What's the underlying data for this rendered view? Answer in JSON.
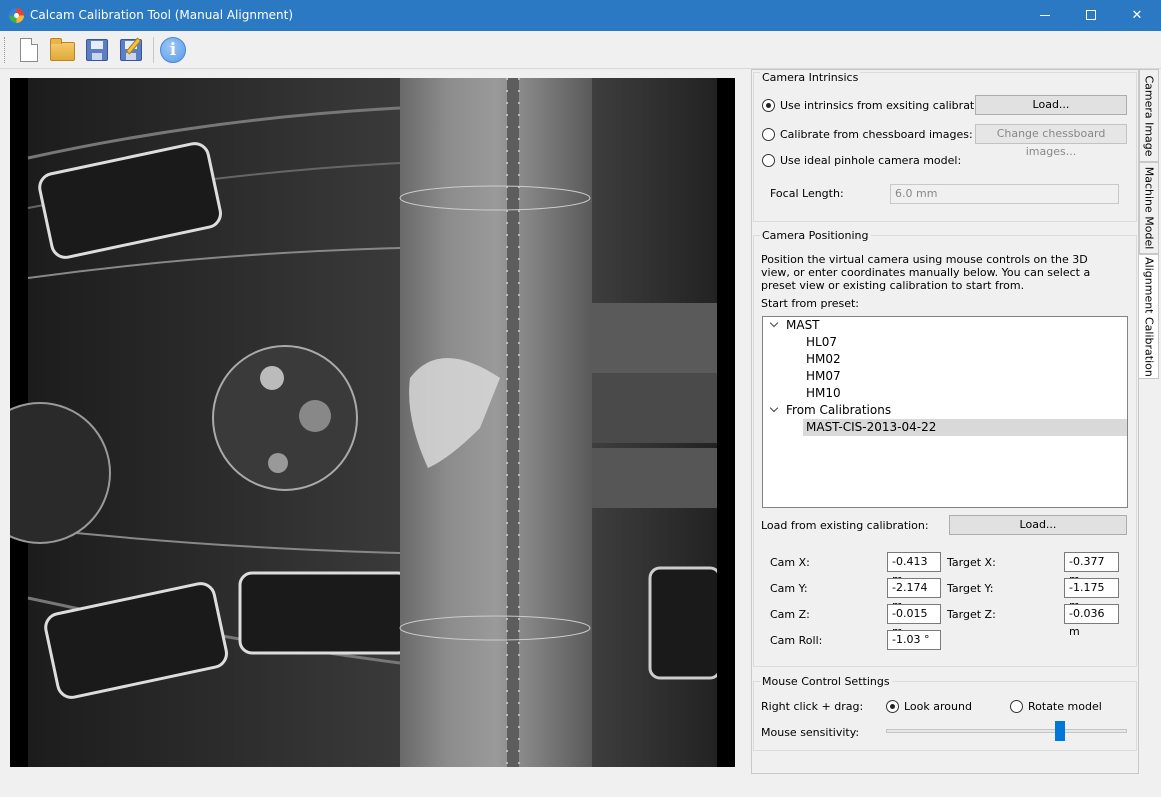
{
  "window": {
    "title": "Calcam Calibration Tool (Manual Alignment)",
    "minimize_glyph": "",
    "maximize_glyph": "",
    "close_glyph": "✕"
  },
  "toolbar": {
    "buttons": [
      "new-file-icon",
      "open-folder-icon",
      "save-icon",
      "save-as-icon",
      "info-icon"
    ],
    "info_glyph": "i"
  },
  "camera_intrinsics": {
    "title": "Camera Intrinsics",
    "option_existing": "Use intrinsics from exsiting calibration:",
    "option_existing_button": "Load...",
    "option_chessboard": "Calibrate from chessboard images:",
    "option_chessboard_button": "Change chessboard images...",
    "option_pinhole": "Use ideal pinhole camera model:",
    "focal_length_label": "Focal Length:",
    "focal_length_value": "6.0 mm",
    "selected": "existing"
  },
  "camera_positioning": {
    "title": "Camera Positioning",
    "description": "Position the virtual camera using mouse controls on the 3D view, or enter coordinates manually below. You can select a preset view or existing calibration to start from.",
    "preset_label": "Start from preset:",
    "tree": {
      "groups": [
        {
          "label": "MAST",
          "items": [
            "HL07",
            "HM02",
            "HM07",
            "HM10"
          ]
        },
        {
          "label": "From Calibrations",
          "items": [
            "MAST-CIS-2013-04-22"
          ]
        }
      ],
      "selected": "MAST-CIS-2013-04-22"
    },
    "load_existing_label": "Load from existing calibration:",
    "load_existing_button": "Load...",
    "cam_x_label": "Cam X:",
    "cam_x": "-0.413 m",
    "cam_y_label": "Cam Y:",
    "cam_y": "-2.174 m",
    "cam_z_label": "Cam Z:",
    "cam_z": "-0.015 m",
    "cam_roll_label": "Cam Roll:",
    "cam_roll": "-1.03 °",
    "target_x_label": "Target X:",
    "target_x": "-0.377 m",
    "target_y_label": "Target Y:",
    "target_y": "-1.175 m",
    "target_z_label": "Target Z:",
    "target_z": "-0.036 m"
  },
  "mouse_control": {
    "title": "Mouse Control Settings",
    "right_click_label": "Right click + drag:",
    "option_look": "Look around",
    "option_rotate": "Rotate model",
    "selected": "look",
    "sensitivity_label": "Mouse sensitivity:",
    "sensitivity_fraction": 0.73
  },
  "side_tabs": {
    "tabs": [
      "Camera Image",
      "Machine Model",
      "Alignment Calibration"
    ],
    "active": "Alignment Calibration"
  },
  "colors": {
    "titlebar": "#2b79c2",
    "slider_handle": "#0078d7"
  }
}
